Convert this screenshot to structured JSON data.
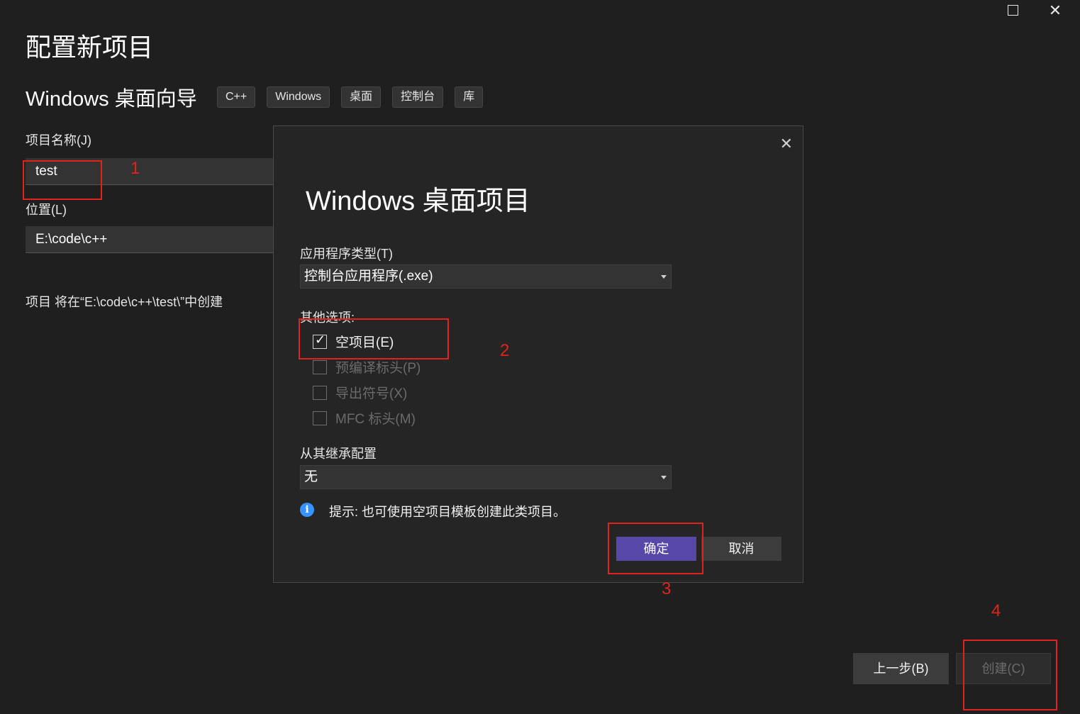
{
  "window": {
    "maximize_label": "",
    "close_label": "✕"
  },
  "page": {
    "title": "配置新项目",
    "template_name": "Windows 桌面向导",
    "tags": [
      "C++",
      "Windows",
      "桌面",
      "控制台",
      "库"
    ]
  },
  "form": {
    "project_name_label": "项目名称(J)",
    "project_name_value": "test",
    "location_label": "位置(L)",
    "location_value": "E:\\code\\c++",
    "path_note": "项目 将在“E:\\code\\c++\\test\\”中创建"
  },
  "dialog": {
    "close_label": "✕",
    "title": "Windows 桌面项目",
    "app_type_label": "应用程序类型(T)",
    "app_type_value": "控制台应用程序(.exe)",
    "other_options_label": "其他选项:",
    "options": [
      {
        "label": "空项目(E)",
        "checked": true,
        "enabled": true
      },
      {
        "label": "预编译标头(P)",
        "checked": false,
        "enabled": false
      },
      {
        "label": "导出符号(X)",
        "checked": false,
        "enabled": false
      },
      {
        "label": "MFC 标头(M)",
        "checked": false,
        "enabled": false
      }
    ],
    "inherit_label": "从其继承配置",
    "inherit_value": "无",
    "hint": "提示: 也可使用空项目模板创建此类项目。",
    "ok_label": "确定",
    "cancel_label": "取消"
  },
  "footer": {
    "back_label": "上一步(B)",
    "create_label": "创建(C)"
  },
  "annotations": {
    "step1": "1",
    "step2": "2",
    "step3": "3",
    "step4": "4"
  },
  "colors": {
    "accent": "#5647a8",
    "annotation": "#e0241b",
    "info": "#3794ff"
  }
}
